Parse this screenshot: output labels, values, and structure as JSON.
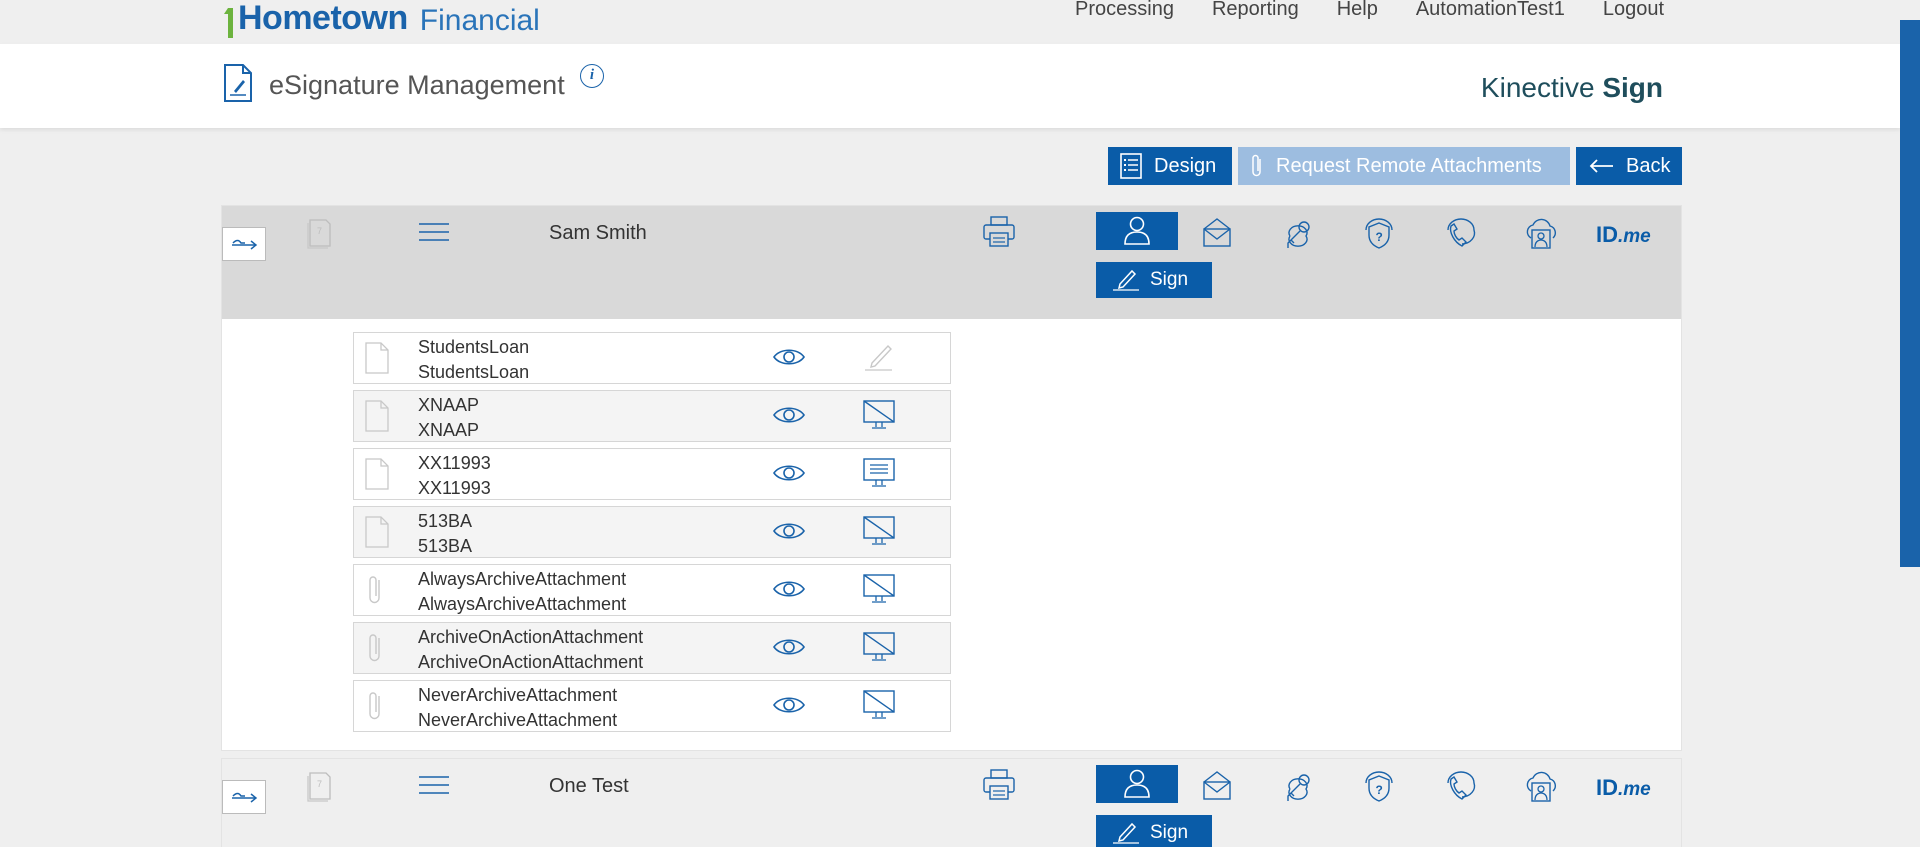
{
  "logo": {
    "primary": "Hometown",
    "secondary": "Financial"
  },
  "nav": [
    "Processing",
    "Reporting",
    "Help",
    "AutomationTest1",
    "Logout"
  ],
  "header": {
    "title": "eSignature Management",
    "info_glyph": "i",
    "brand_normal": "Kinective",
    "brand_bold": "Sign"
  },
  "actions": {
    "design": "Design",
    "request_remote": "Request Remote Attachments",
    "back": "Back",
    "request_remote_disabled": true
  },
  "signers": [
    {
      "name": "Sam Smith",
      "sign_label": "Sign",
      "idme_text": "ID",
      "idme_suffix": ".me",
      "methods": [
        "in-person-icon",
        "email-icon",
        "key-icon",
        "shield-question-icon",
        "phone-icon",
        "cloud-user-icon",
        "idme-logo"
      ],
      "documents": [
        {
          "line1": "StudentsLoan",
          "line2": "StudentsLoan",
          "type": "document-icon",
          "action": "pen-signed-icon"
        },
        {
          "line1": "XNAAP",
          "line2": "XNAAP",
          "type": "document-icon",
          "action": "monitor-disabled-icon"
        },
        {
          "line1": "XX11993",
          "line2": "XX11993",
          "type": "document-icon",
          "action": "monitor-active-icon"
        },
        {
          "line1": "513BA",
          "line2": "513BA",
          "type": "document-icon",
          "action": "monitor-disabled-icon"
        },
        {
          "line1": "AlwaysArchiveAttachment",
          "line2": "AlwaysArchiveAttachment",
          "type": "paperclip-icon",
          "action": "monitor-disabled-icon"
        },
        {
          "line1": "ArchiveOnActionAttachment",
          "line2": "ArchiveOnActionAttachment",
          "type": "paperclip-icon",
          "action": "monitor-disabled-icon"
        },
        {
          "line1": "NeverArchiveAttachment",
          "line2": "NeverArchiveAttachment",
          "type": "paperclip-icon",
          "action": "monitor-disabled-icon"
        }
      ]
    },
    {
      "name": "One Test",
      "sign_label": "Sign",
      "idme_text": "ID",
      "idme_suffix": ".me",
      "methods": [
        "in-person-icon",
        "email-icon",
        "key-icon",
        "shield-question-icon",
        "phone-icon",
        "cloud-user-icon",
        "idme-logo"
      ],
      "documents": []
    }
  ],
  "colors": {
    "primary": "#0a5ca8",
    "disabled": "#9dbde0",
    "panel_head": "#d9d9d9",
    "page_bg": "#efefef"
  }
}
